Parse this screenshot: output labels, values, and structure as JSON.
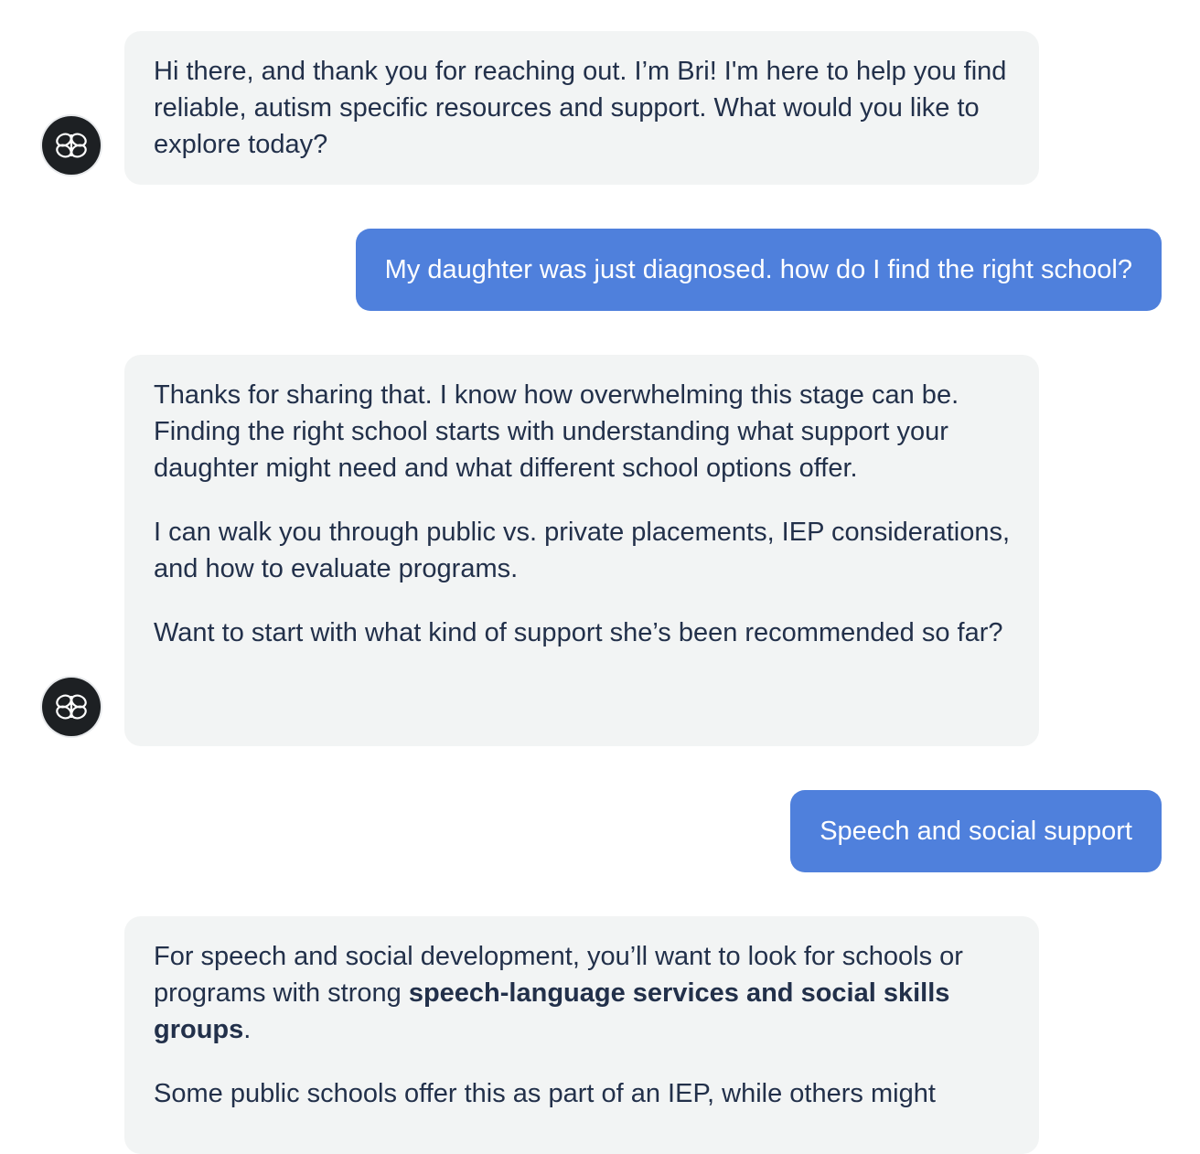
{
  "messages": [
    {
      "role": "assistant",
      "paragraphs": [
        "Hi there, and thank you for reaching out. I’m Bri! I'm here to help you find reliable, autism specific resources and support. What would you like to explore today?"
      ]
    },
    {
      "role": "user",
      "text": "My daughter was just diagnosed. how do I find the right school?"
    },
    {
      "role": "assistant",
      "paragraphs": [
        "Thanks for sharing that. I know how overwhelming this stage can be. Finding the right school starts with understanding what support your daughter might need and what different school options offer.",
        "I can walk you through public vs. private placements, IEP considerations, and how to evaluate programs.",
        "Want to start with what kind of support she’s been recommended so far?"
      ]
    },
    {
      "role": "user",
      "text": "Speech and social support"
    },
    {
      "role": "assistant",
      "p1_before": "For speech and social development, you’ll want to look for schools or programs with strong ",
      "p1_bold": "speech-language services and social skills groups",
      "p1_after": ".",
      "p2": "Some public schools offer this as part of an IEP, while others might"
    }
  ],
  "avatar": {
    "icon": "butterfly-logo-icon",
    "background": "#1d2023"
  },
  "colors": {
    "bot_bubble": "#f2f4f4",
    "user_bubble": "#4f80dc",
    "text": "#22304a"
  }
}
